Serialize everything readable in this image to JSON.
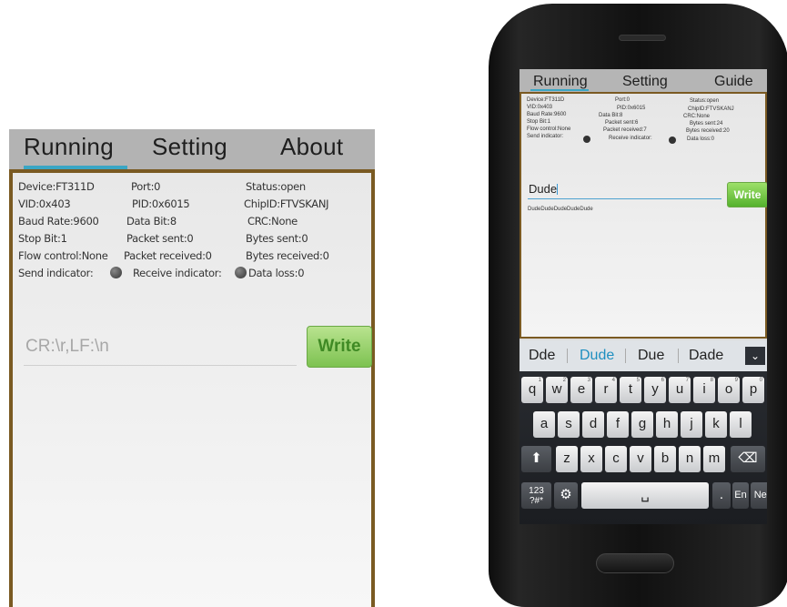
{
  "left": {
    "tabs": [
      "Running",
      "Setting",
      "About"
    ],
    "info": {
      "device": "Device:FT311D",
      "port": "Port:0",
      "status": "Status:open",
      "vid": "VID:0x403",
      "pid": "PID:0x6015",
      "chip": "ChipID:FTVSKANJ",
      "baud": "Baud Rate:9600",
      "databit": "Data Bit:8",
      "crc": "CRC:None",
      "stopbit": "Stop Bit:1",
      "packet_sent": "Packet sent:0",
      "bytes_sent": "Bytes sent:0",
      "flow": "Flow control:None",
      "packet_received": "Packet received:0",
      "bytes_received": "Bytes received:0",
      "send_ind": "Send indicator:",
      "recv_ind": "Receive indicator:",
      "data_loss": "Data loss:0"
    },
    "input_placeholder": "CR:\\r,LF:\\n",
    "write_label": "Write"
  },
  "phone": {
    "tabs": [
      "Running",
      "Setting",
      "Guide"
    ],
    "info": {
      "device": "Device:FT311D",
      "port": "Port:0",
      "status": "Status:open",
      "vid": "VID:0x403",
      "pid": "PID:0x6015",
      "chip": "ChipID:FTVSKANJ",
      "baud": "Baud Rate:9600",
      "databit": "Data Bit:8",
      "crc": "CRC:None",
      "stopbit": "Stop Bit:1",
      "packet_sent": "Packet sent:6",
      "bytes_sent": "Bytes sent:24",
      "flow": "Flow control:None",
      "packet_received": "Packet received:7",
      "bytes_received": "Bytes received:20",
      "send_ind": "Send indicator:",
      "recv_ind": "Receive indicator:",
      "data_loss": "Data loss:0"
    },
    "input_value": "Dude",
    "write_label": "Write",
    "received_text": "DudeDudeDudeDudeDude",
    "suggestions": [
      "Dde",
      "Dude",
      "Due",
      "Dade"
    ],
    "suggest_chevron": "⌄",
    "keys_row1": [
      {
        "k": "q",
        "s": "1"
      },
      {
        "k": "w",
        "s": "2"
      },
      {
        "k": "e",
        "s": "3"
      },
      {
        "k": "r",
        "s": "4"
      },
      {
        "k": "t",
        "s": "5"
      },
      {
        "k": "y",
        "s": "6"
      },
      {
        "k": "u",
        "s": "7"
      },
      {
        "k": "i",
        "s": "8"
      },
      {
        "k": "o",
        "s": "9"
      },
      {
        "k": "p",
        "s": "0"
      }
    ],
    "keys_row2": [
      "a",
      "s",
      "d",
      "f",
      "g",
      "h",
      "j",
      "k",
      "l"
    ],
    "keys_row3": [
      "z",
      "x",
      "c",
      "v",
      "b",
      "n",
      "m"
    ],
    "shift_icon": "⬆",
    "backspace_icon": "⌫",
    "symbols_label": "123\n?#*",
    "settings_icon": "⚙",
    "space_icon": "␣",
    "period_label": ".",
    "lang_label": "En",
    "next_label": "Next"
  }
}
